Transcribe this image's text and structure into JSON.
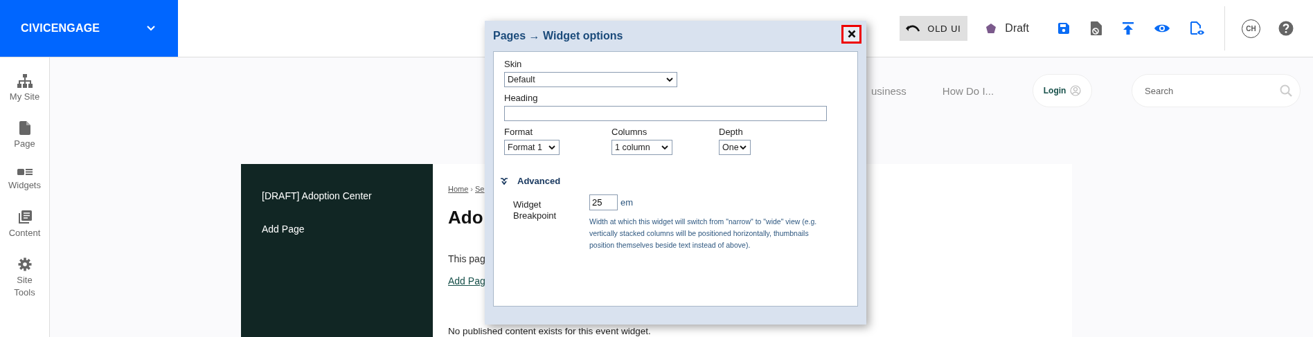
{
  "brand": {
    "name": "CIVICENGAGE"
  },
  "toolbar": {
    "old_ui": "OLD UI",
    "status": {
      "label": "Draft",
      "color": "#7b5a8c"
    },
    "user_initials": "CH"
  },
  "sidebar": {
    "items": [
      {
        "label": "My Site",
        "kind": "sitemap"
      },
      {
        "label": "Page",
        "kind": "page"
      },
      {
        "label": "Widgets",
        "kind": "widgets"
      },
      {
        "label": "Content",
        "kind": "content"
      },
      {
        "label": "Site Tools",
        "kind": "tools"
      }
    ]
  },
  "site_nav": {
    "items": [
      "usiness",
      "How Do I..."
    ],
    "login": "Login",
    "search": {
      "placeholder": "Search"
    }
  },
  "page": {
    "menu": [
      "[DRAFT] Adoption Center",
      "Add Page"
    ],
    "breadcrumb": [
      "Home",
      "Se"
    ],
    "breadcrumb_separator": "›",
    "heading": "Ado",
    "intro": "This pag",
    "link": "Add Pag",
    "empty_message": "No published content exists for this event widget."
  },
  "dialog": {
    "title": "Pages → Widget options",
    "skin": {
      "label": "Skin",
      "value": "Default"
    },
    "heading": {
      "label": "Heading"
    },
    "options": [
      {
        "label": "Format",
        "value": "Format 1"
      },
      {
        "label": "Columns",
        "value": "1 column"
      },
      {
        "label": "Depth",
        "value": "One"
      }
    ],
    "advanced": {
      "label": "Advanced",
      "expanded": true,
      "breakpoint": {
        "label": "Widget Breakpoint",
        "value": "25",
        "unit": "em",
        "help": "Width at which this widget will switch from \"narrow\" to \"wide\" view (e.g. vertically stacked columns will be positioned horizontally, thumbnails position themselves beside text instead of above)."
      }
    }
  }
}
